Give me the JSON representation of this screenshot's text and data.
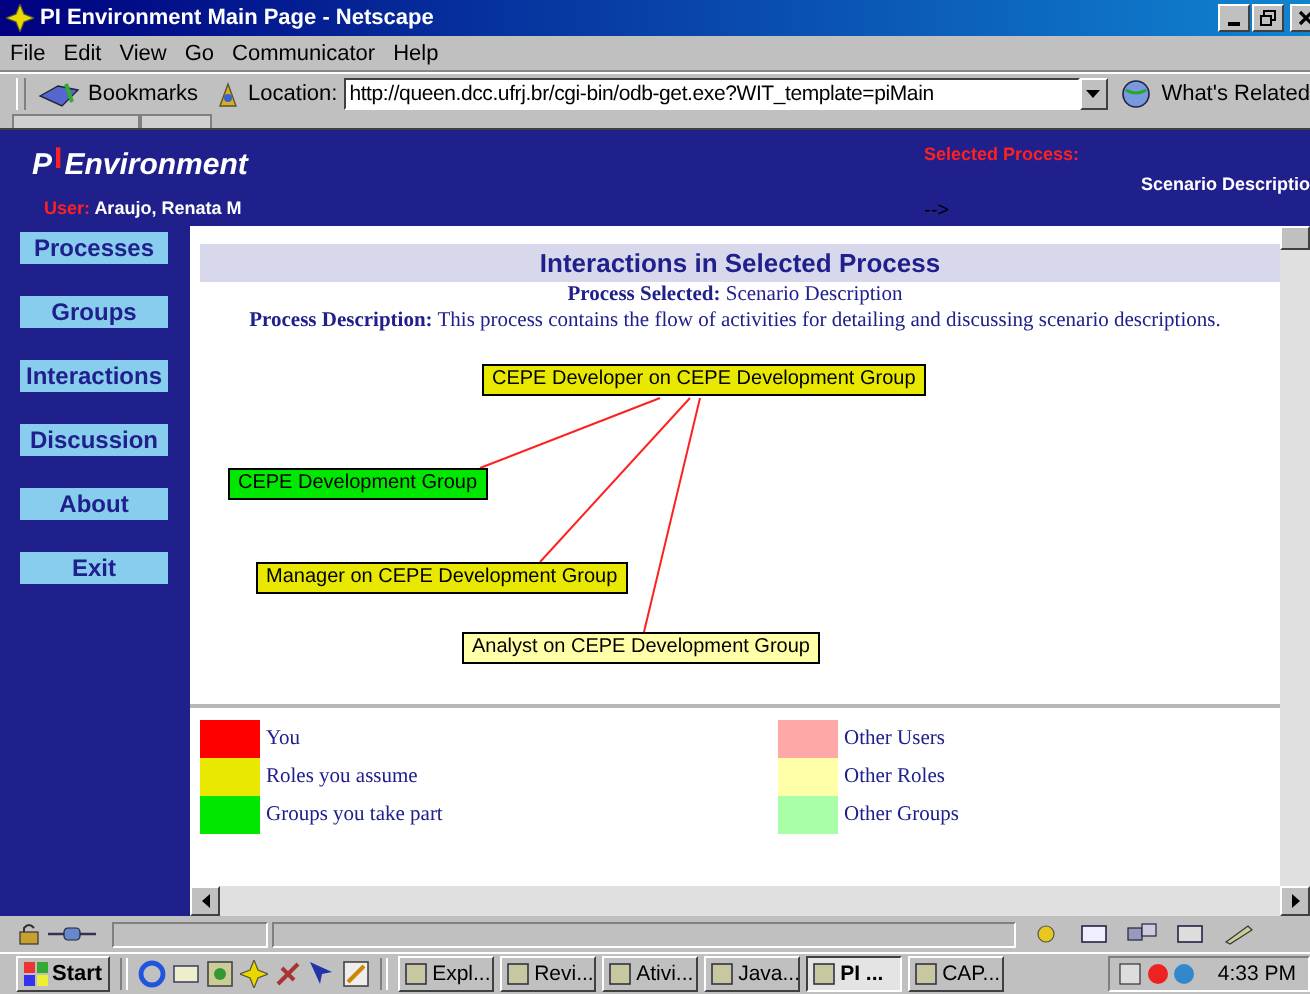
{
  "window": {
    "title": "PI Environment Main Page - Netscape"
  },
  "menu": [
    "File",
    "Edit",
    "View",
    "Go",
    "Communicator",
    "Help"
  ],
  "toolbar": {
    "bookmarks": "Bookmarks",
    "location_label": "Location:",
    "url": "http://queen.dcc.ufrj.br/cgi-bin/odb-get.exe?WIT_template=piMain",
    "related": "What's Related"
  },
  "header": {
    "logo": [
      {
        "text": "P",
        "accent": false
      },
      {
        "text": "I",
        "accent": true
      },
      {
        "text": "Environment",
        "accent": false
      }
    ],
    "user_label": "User:",
    "user": "Araujo, Renata M",
    "selected_label": "Selected Process:",
    "selected": "Scenario Descriptio",
    "arrow": "-->"
  },
  "sidebar": {
    "items": [
      {
        "label": "Processes"
      },
      {
        "label": "Groups"
      },
      {
        "label": "Interactions"
      },
      {
        "label": "Discussion"
      },
      {
        "label": "About"
      },
      {
        "label": "Exit"
      }
    ]
  },
  "content": {
    "heading": "Interactions in Selected Process",
    "process_line": "**Process Selected:** Scenario Description",
    "description_line": "**Process Description:** This process contains the flow of activities for detailing and discussing scenario descriptions."
  },
  "diagram": {
    "nodes": [
      {
        "label": "CEPE Developer on CEPE Development Group",
        "color": "#e8e800",
        "kind": "hub"
      },
      {
        "label": "CEPE Development Group",
        "color": "#00e800",
        "kind": "linked"
      },
      {
        "label": "Manager on CEPE Development Group",
        "color": "#e8e800",
        "kind": "linked"
      },
      {
        "label": "Analyst on CEPE Development Group",
        "color": "#ffffa8",
        "kind": "linked"
      }
    ]
  },
  "legend": [
    {
      "label": "You",
      "color": "#ff0000"
    },
    {
      "label": "Other Users",
      "color": "#ffa8a8"
    },
    {
      "label": "Roles you assume",
      "color": "#e8e800"
    },
    {
      "label": "Other Roles",
      "color": "#ffffa8"
    },
    {
      "label": "Groups you take part",
      "color": "#00e800"
    },
    {
      "label": "Other Groups",
      "color": "#a8ffa8"
    }
  ],
  "taskbar": {
    "start": "Start",
    "tasks": [
      {
        "label": "Expl...",
        "selected": false
      },
      {
        "label": "Revi...",
        "selected": false
      },
      {
        "label": "Ativi...",
        "selected": false
      },
      {
        "label": "Java...",
        "selected": false
      },
      {
        "label": "PI ...",
        "selected": true
      },
      {
        "label": "CAP...",
        "selected": false
      }
    ],
    "clock": "4:33 PM"
  }
}
